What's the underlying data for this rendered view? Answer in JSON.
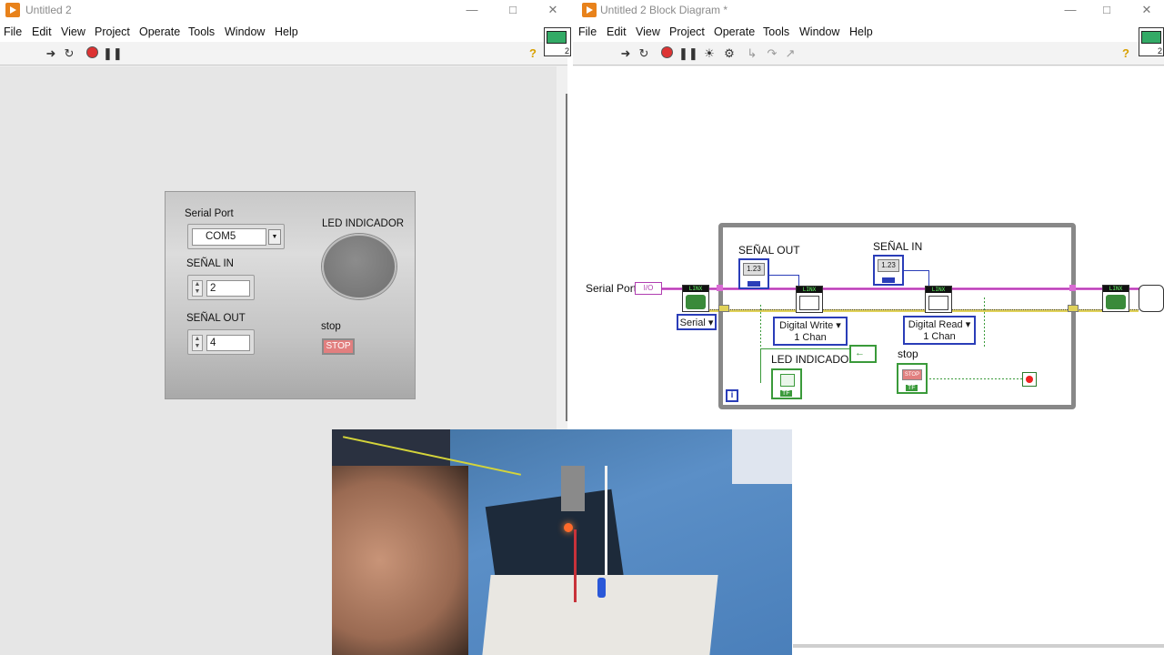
{
  "front_panel": {
    "window_title": "Untitled 2",
    "menus": [
      "File",
      "Edit",
      "View",
      "Project",
      "Operate",
      "Tools",
      "Window",
      "Help"
    ],
    "connector_pane_number": "2",
    "controls": {
      "serial_port": {
        "label": "Serial Port",
        "value": "COM5"
      },
      "senal_in": {
        "label": "SEÑAL IN",
        "value": "2"
      },
      "senal_out": {
        "label": "SEÑAL OUT",
        "value": "4"
      },
      "led": {
        "label": "LED INDICADOR",
        "state": "off"
      },
      "stop": {
        "label": "stop",
        "button_text": "STOP"
      }
    }
  },
  "block_diagram": {
    "window_title": "Untitled 2 Block Diagram *",
    "menus": [
      "File",
      "Edit",
      "View",
      "Project",
      "Operate",
      "Tools",
      "Window",
      "Help"
    ],
    "connector_pane_number": "2",
    "nodes": {
      "serial_port_label": "Serial Port",
      "serial_port_const": "I/O",
      "serial_enum": "Serial",
      "senal_out_label": "SEÑAL OUT",
      "senal_in_label": "SEÑAL IN",
      "numeric_text": "1.23",
      "numeric_type": "U8",
      "linx_header": "LINX",
      "digital_write": [
        "Digital Write",
        "1 Chan"
      ],
      "digital_read": [
        "Digital Read",
        "1 Chan"
      ],
      "led_label": "LED INDICADOR",
      "bool_type": "TF",
      "stop_label": "stop",
      "stop_text": "STOP",
      "iteration": "i"
    }
  },
  "colors": {
    "labview_orange": "#e8821b",
    "error_wire": "#e0d25a",
    "visa_wire": "#d86bd3",
    "numeric_blue": "#2a3db8",
    "boolean_green": "#3a9a3a"
  }
}
